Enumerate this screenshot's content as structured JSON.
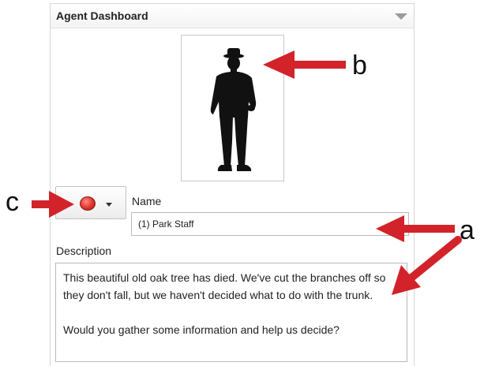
{
  "panel": {
    "title": "Agent Dashboard"
  },
  "agent": {
    "name_label": "Name",
    "name_value": "(1) Park Staff",
    "description_label": "Description",
    "description_paragraphs": [
      "This beautiful old oak tree has died. We've cut the branches off so they don't fall, but we haven't decided what to do with the trunk.",
      "Would you gather some information and help us decide?"
    ],
    "status_color": "#e0332b"
  },
  "callouts": {
    "a": "a",
    "b": "b",
    "c": "c"
  },
  "colors": {
    "arrow": "#d2232a",
    "silhouette": "#111111"
  }
}
